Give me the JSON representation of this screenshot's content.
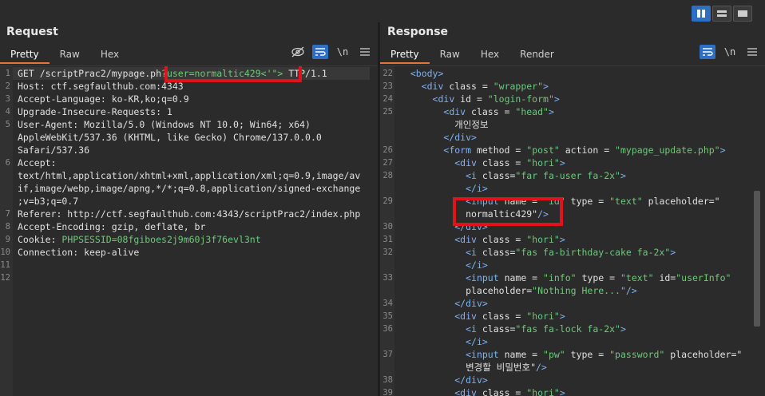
{
  "layout_toggle": {
    "icons": [
      "columns-icon",
      "rows-icon",
      "single-icon"
    ]
  },
  "request": {
    "title": "Request",
    "tabs": [
      "Pretty",
      "Raw",
      "Hex"
    ],
    "tools": {
      "eye": "",
      "wrap": "",
      "newline": "\\n",
      "menu": ""
    },
    "lines": [
      {
        "n": "1",
        "parts": [
          "GET /scriptPrac2/mypage.ph",
          "?user=normaltic429<'\">",
          " TTP/1.1"
        ]
      },
      {
        "n": "2",
        "parts": [
          "Host: ctf.segfaulthub.com:4343"
        ]
      },
      {
        "n": "3",
        "parts": [
          "Accept-Language: ko-KR,ko;q=0.9"
        ]
      },
      {
        "n": "4",
        "parts": [
          "Upgrade-Insecure-Requests: 1"
        ]
      },
      {
        "n": "5",
        "parts": [
          "User-Agent: Mozilla/5.0 (Windows NT 10.0; Win64; x64)"
        ]
      },
      {
        "n": "",
        "parts": [
          "AppleWebKit/537.36 (KHTML, like Gecko) Chrome/137.0.0.0"
        ]
      },
      {
        "n": "",
        "parts": [
          "Safari/537.36"
        ]
      },
      {
        "n": "6",
        "parts": [
          "Accept:"
        ]
      },
      {
        "n": "",
        "parts": [
          "text/html,application/xhtml+xml,application/xml;q=0.9,image/av"
        ]
      },
      {
        "n": "",
        "parts": [
          "if,image/webp,image/apng,*/*;q=0.8,application/signed-exchange"
        ]
      },
      {
        "n": "",
        "parts": [
          ";v=b3;q=0.7"
        ]
      },
      {
        "n": "7",
        "parts": [
          "Referer: http://ctf.segfaulthub.com:4343/scriptPrac2/index.php"
        ]
      },
      {
        "n": "8",
        "parts": [
          "Accept-Encoding: gzip, deflate, br"
        ]
      },
      {
        "n": "9",
        "parts": [
          "Cookie: ",
          "PHPSESSID=08fgiboes2j9m60j3f76evl3nt"
        ]
      },
      {
        "n": "10",
        "parts": [
          "Connection: keep-alive"
        ]
      },
      {
        "n": "11",
        "parts": [
          ""
        ]
      },
      {
        "n": "12",
        "parts": [
          ""
        ]
      }
    ]
  },
  "response": {
    "title": "Response",
    "tabs": [
      "Pretty",
      "Raw",
      "Hex",
      "Render"
    ],
    "tools": {
      "wrap": "",
      "newline": "\\n",
      "menu": ""
    },
    "lines": [
      {
        "n": "22",
        "text": "  <body>"
      },
      {
        "n": "23",
        "text": "    <div class = \"wrapper\">"
      },
      {
        "n": "24",
        "text": "      <div id = \"login-form\">"
      },
      {
        "n": "25",
        "text": "        <div class = \"head\">"
      },
      {
        "n": "",
        "text": "          개인정보"
      },
      {
        "n": "",
        "text": "        </div>"
      },
      {
        "n": "26",
        "text": "        <form method = \"post\" action = \"mypage_update.php\">"
      },
      {
        "n": "27",
        "text": "          <div class = \"hori\">"
      },
      {
        "n": "28",
        "text": "            <i class=\"far fa-user fa-2x\">"
      },
      {
        "n": "",
        "text": "            </i>"
      },
      {
        "n": "29",
        "text": "            <input name = \"id\" type = \"text\" placeholder=\""
      },
      {
        "n": "",
        "text": "            normaltic429\"/>"
      },
      {
        "n": "30",
        "text": "          </div>"
      },
      {
        "n": "31",
        "text": "          <div class = \"hori\">"
      },
      {
        "n": "32",
        "text": "            <i class=\"fas fa-birthday-cake fa-2x\">"
      },
      {
        "n": "",
        "text": "            </i>"
      },
      {
        "n": "33",
        "text": "            <input name = \"info\" type = \"text\" id=\"userInfo\""
      },
      {
        "n": "",
        "text": "            placeholder=\"Nothing Here...\"/>"
      },
      {
        "n": "34",
        "text": "          </div>"
      },
      {
        "n": "35",
        "text": "          <div class = \"hori\">"
      },
      {
        "n": "36",
        "text": "            <i class=\"fas fa-lock fa-2x\">"
      },
      {
        "n": "",
        "text": "            </i>"
      },
      {
        "n": "37",
        "text": "            <input name = \"pw\" type = \"password\" placeholder=\""
      },
      {
        "n": "",
        "text": "            변경할 비밀번호\"/>"
      },
      {
        "n": "38",
        "text": "          </div>"
      },
      {
        "n": "39",
        "text": "          <div class = \"hori\">"
      }
    ]
  }
}
